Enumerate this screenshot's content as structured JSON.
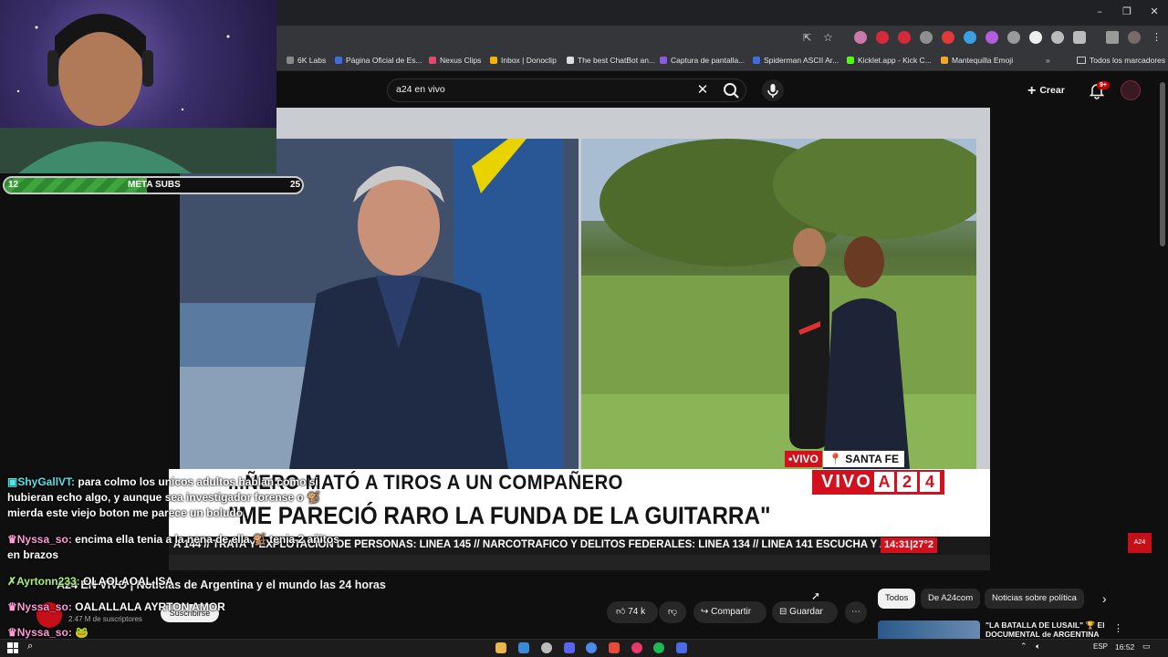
{
  "browser": {
    "bookmarks": [
      {
        "label": "6K Labs",
        "color": "#888888"
      },
      {
        "label": "Página Oficial de Es...",
        "color": "#3b6ee0"
      },
      {
        "label": "Nexus Clips",
        "color": "#e04a6a"
      },
      {
        "label": "Inbox | Donoclip",
        "color": "#f5b400"
      },
      {
        "label": "The best ChatBot an...",
        "color": "#dddddd"
      },
      {
        "label": "Captura de pantalla...",
        "color": "#8a5be0"
      },
      {
        "label": "Spiderman ASCII Ar...",
        "color": "#3b6ee0"
      },
      {
        "label": "Kicklet.app - Kick C...",
        "color": "#53fc18"
      },
      {
        "label": "Mantequilla Emoji",
        "color": "#f5a623"
      }
    ],
    "bookmarks_all": "Todos los marcadores"
  },
  "youtube": {
    "search_query": "a24 en vivo",
    "create_label": "Crear",
    "notif_count": "9+"
  },
  "video": {
    "live_label": "•VIVO",
    "location": "SANTA FE",
    "headline1": "...ÑERO MATÓ A TIROS A UN COMPAÑERO",
    "headline2": "\"ME PARECIÓ RARO LA FUNDA DE LA GUITARRA\"",
    "vivo_word": "VIVO",
    "brand_letters": [
      "A",
      "2",
      "4"
    ],
    "ticker": "A 144 // TRATA Y EXPLOTACIÓN DE PERSONAS: LÍNEA 145 // NARCOTRÁFICO Y DELITOS FEDERALES: LÍNEA 134 // LÍNEA 141 ESCUCHA Y ASIST",
    "ticker_time": "14:31|27°2",
    "corner_logo": "A24"
  },
  "stream_overlay": {
    "meta_start": "12",
    "meta_label": "META SUBS",
    "meta_end": "25",
    "meta_progress": 0.48,
    "chat": [
      {
        "user": "ShyGallVT",
        "text": "para colmo los unicos adultos hablan como si hubieran echo algo, y aunque sea investigador forense o 🐒 mierda este viejo boton me parece un boludo",
        "color": "cyan"
      },
      {
        "user": "Nyssa_so",
        "text": "encima ella tenia a la nena de ella 🐒 tenia 2 añitos en brazos",
        "color": "pink"
      },
      {
        "user": "Ayrtonn233",
        "text": "OLAOLAOAL ISA",
        "color": "green"
      },
      {
        "user": "Nyssa_so",
        "text": "OALALLALA AYRTON AMOR",
        "color": "pink"
      },
      {
        "user": "Nyssa_so",
        "text": "🐸",
        "color": "pink"
      }
    ]
  },
  "video_info": {
    "title": "A24 EN VIVO | Noticias de Argentina y el mundo las 24 horas",
    "subs": "2.47 M de suscriptores",
    "subscribe": "Suscribirse",
    "likes": "74 k",
    "share": "Compartir",
    "save": "Guardar"
  },
  "chips": [
    "Todos",
    "De A24com",
    "Noticias sobre política"
  ],
  "recommended": {
    "title": "\"LA BATALLA DE LUSAIL\" 🏆 El DOCUMENTAL de ARGENTINA"
  },
  "taskbar": {
    "lang": "ESP",
    "time": "16:52"
  }
}
